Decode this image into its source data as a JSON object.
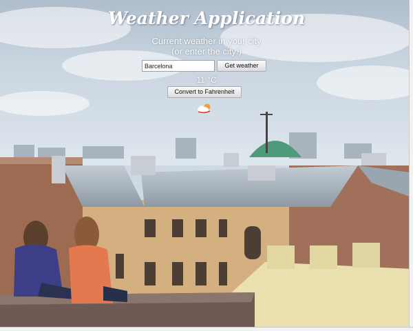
{
  "app": {
    "title": "Weather Application",
    "subtitle_line1": "Current weather in your city",
    "subtitle_line2": "(or enter the city:)"
  },
  "search": {
    "city_value": "Barcelona",
    "get_weather_label": "Get weather"
  },
  "weather": {
    "temperature": "11 °C",
    "icon": "partly-cloudy-icon"
  },
  "convert": {
    "label": "Convert to Fahrenheit"
  },
  "colors": {
    "sky": "#cfd9e3",
    "title_text": "#ffffff",
    "roof_steel": "#a9b4bd",
    "brick": "#9c6b52",
    "facade": "#d9b98a"
  }
}
